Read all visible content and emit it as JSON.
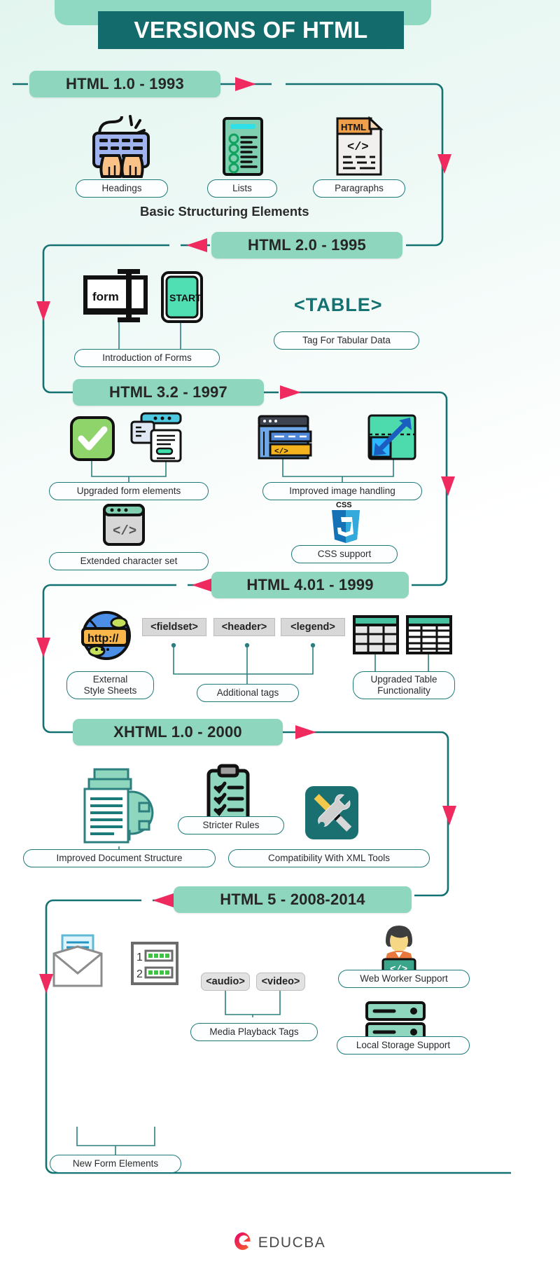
{
  "header": {
    "title": "VERSIONS OF HTML"
  },
  "versions": [
    {
      "id": "html1",
      "chip": "HTML 1.0 - 1993",
      "caption": "Basic Structuring Elements",
      "labels": [
        "Headings",
        "Lists",
        "Paragraphs"
      ],
      "icons": [
        "keyboard-typing-icon",
        "checklist-icon",
        "html-document-icon"
      ]
    },
    {
      "id": "html2",
      "chip": "HTML 2.0 - 1995",
      "bigtag": "<TABLE>",
      "labels": [
        "Introduction of Forms",
        "Tag For Tabular Data"
      ],
      "icons": [
        "form-window-icon",
        "start-button-icon"
      ],
      "icon_text": {
        "form": "form",
        "start": "START"
      }
    },
    {
      "id": "html32",
      "chip": "HTML 3.2 - 1997",
      "labels": [
        "Upgraded form elements",
        "Improved image handling",
        "Extended character set",
        "CSS support"
      ],
      "icons": [
        "green-check-icon",
        "form-elements-icon",
        "code-window-icon",
        "image-scale-icon",
        "character-code-icon",
        "css3-logo-icon"
      ],
      "icon_text": {
        "css": "CSS"
      }
    },
    {
      "id": "html401",
      "chip": "HTML 4.01 - 1999",
      "tags": [
        "<fieldset>",
        "<header>",
        "<legend>"
      ],
      "labels": [
        "External\nStyle Sheets",
        "Additional tags",
        "Upgraded Table\nFunctionality"
      ],
      "labels_lines": [
        [
          "External",
          "Style Sheets"
        ],
        [
          "Additional tags"
        ],
        [
          "Upgraded Table",
          "Functionality"
        ]
      ],
      "icons": [
        "http-globe-icon",
        "table-grid-icon",
        "table-grid-icon"
      ],
      "icon_text": {
        "http": "http://"
      }
    },
    {
      "id": "xhtml1",
      "chip": "XHTML 1.0 - 2000",
      "labels": [
        "Stricter Rules",
        "Improved Document Structure",
        "Compatibility With XML Tools"
      ],
      "icons": [
        "document-gear-icon",
        "clipboard-checklist-icon",
        "tools-wrench-screwdriver-icon"
      ]
    },
    {
      "id": "html5",
      "chip": "HTML 5 - 2008-2014",
      "tags": [
        "<audio>",
        "<video>"
      ],
      "labels": [
        "New Form Elements",
        "Media Playback Tags",
        "Web Worker Support",
        "Local Storage Support"
      ],
      "icons": [
        "email-form-icon",
        "numbered-input-icon",
        "web-developer-icon",
        "server-storage-icon"
      ],
      "icon_text": {
        "row1": "1",
        "row2": "2"
      }
    }
  ],
  "footer": {
    "brand": "EDUCBA",
    "logo": "educba-logo-icon"
  },
  "colors": {
    "teal_dark": "#146b6b",
    "mint": "#8ed6bd",
    "pink": "#ee2a5f",
    "line": "#1d7a7a",
    "grey_tag": "#d8d8d8"
  }
}
